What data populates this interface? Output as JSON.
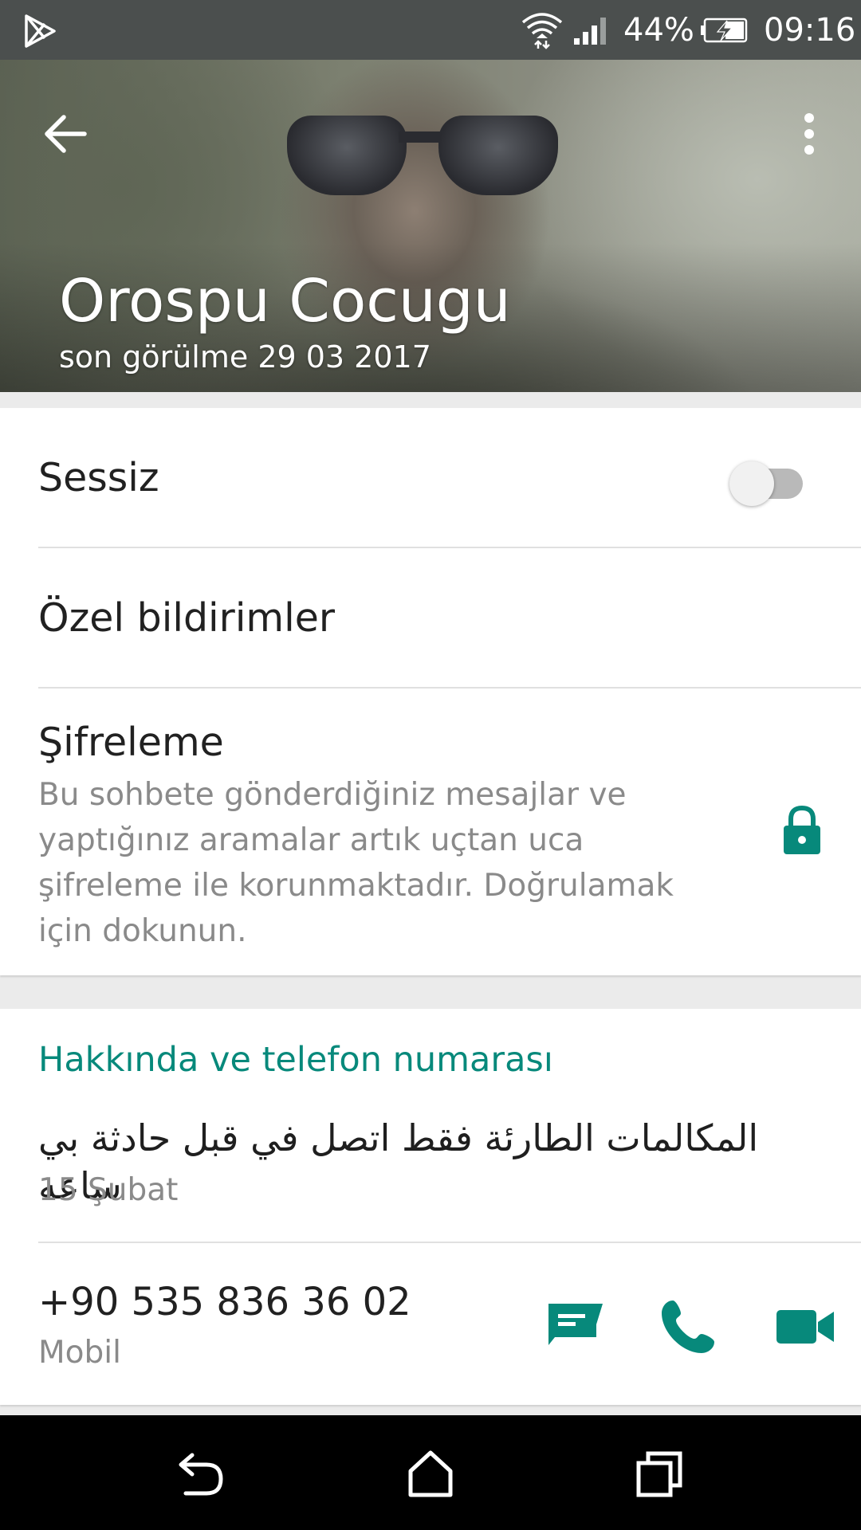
{
  "status_bar": {
    "battery_percent": "44%",
    "time": "09:16",
    "icons": [
      "play-store-icon",
      "wifi-icon",
      "signal-icon",
      "battery-charging-icon"
    ]
  },
  "header": {
    "contact_name": "Orospu Cocugu",
    "last_seen": "son görülme 29 03 2017",
    "icons": [
      "back-arrow-icon",
      "more-vert-icon"
    ]
  },
  "settings": {
    "mute_label": "Sessiz",
    "mute_enabled": false,
    "custom_notifications_label": "Özel bildirimler",
    "encryption_label": "Şifreleme",
    "encryption_description": "Bu sohbete gönderdiğiniz mesajlar ve yaptığınız aramalar artık uçtan uca şifreleme ile korunmaktadır. Doğrulamak için dokunun.",
    "encryption_icon": "lock-icon"
  },
  "about": {
    "section_title": "Hakkında ve telefon numarası",
    "status_text": "المكالمات الطارئة فقط اتصل في قبل حادثة بي ساعه",
    "status_date": "15 Şubat",
    "phone_number": "+90 535 836 36 02",
    "phone_type": "Mobil",
    "icons": [
      "message-icon",
      "phone-icon",
      "video-call-icon"
    ]
  },
  "nav_bar": {
    "icons": [
      "nav-back-icon",
      "nav-home-icon",
      "nav-recents-icon"
    ]
  },
  "colors": {
    "accent": "#07897b",
    "status_bar": "#4b4f4e",
    "nav_bar": "#000000"
  }
}
